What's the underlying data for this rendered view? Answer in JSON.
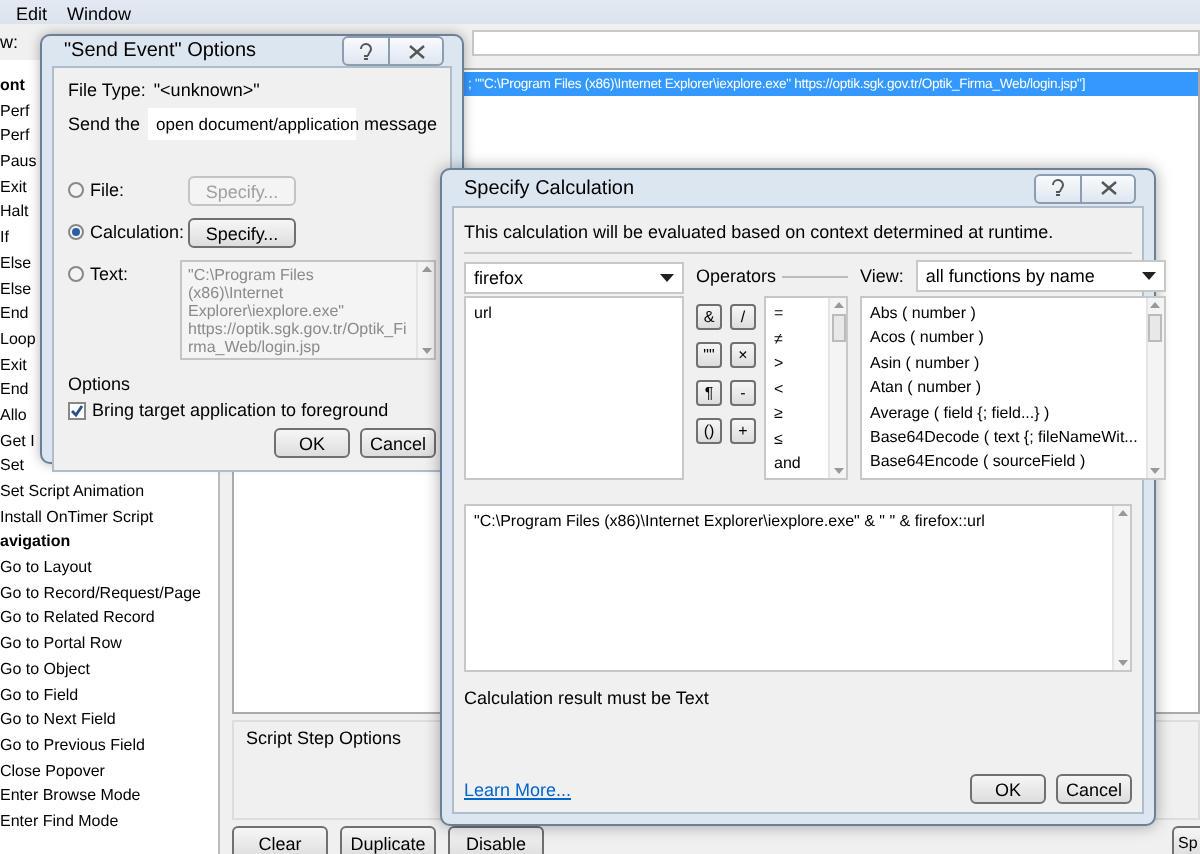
{
  "menu": [
    {
      "label": "Edit"
    },
    {
      "label": "Window"
    }
  ],
  "toolbar": {
    "label": "w:"
  },
  "steps": [
    {
      "label": "ont",
      "kind": "header"
    },
    {
      "label": "Perf",
      "kind": "step"
    },
    {
      "label": "Perf",
      "kind": "step"
    },
    {
      "label": "Paus",
      "kind": "step"
    },
    {
      "label": "Exit",
      "kind": "step"
    },
    {
      "label": "Halt",
      "kind": "step"
    },
    {
      "label": "If",
      "kind": "step"
    },
    {
      "label": "Else",
      "kind": "step"
    },
    {
      "label": "Else",
      "kind": "step"
    },
    {
      "label": "End",
      "kind": "step"
    },
    {
      "label": "Loop",
      "kind": "step"
    },
    {
      "label": "Exit",
      "kind": "step"
    },
    {
      "label": "End",
      "kind": "step"
    },
    {
      "label": "Allo",
      "kind": "step"
    },
    {
      "label": "Get I",
      "kind": "step"
    },
    {
      "label": "Set",
      "kind": "step"
    },
    {
      "label": "Set Script Animation",
      "kind": "step"
    },
    {
      "label": "Install OnTimer Script",
      "kind": "step"
    },
    {
      "label": "avigation",
      "kind": "header"
    },
    {
      "label": "Go to Layout",
      "kind": "step"
    },
    {
      "label": "Go to Record/Request/Page",
      "kind": "step"
    },
    {
      "label": "Go to Related Record",
      "kind": "step"
    },
    {
      "label": "Go to Portal Row",
      "kind": "step"
    },
    {
      "label": "Go to Object",
      "kind": "step"
    },
    {
      "label": "Go to Field",
      "kind": "step"
    },
    {
      "label": "Go to Next Field",
      "kind": "step"
    },
    {
      "label": "Go to Previous Field",
      "kind": "step"
    },
    {
      "label": "Close Popover",
      "kind": "step"
    },
    {
      "label": "Enter Browse Mode",
      "kind": "step"
    },
    {
      "label": "Enter Find Mode",
      "kind": "step"
    }
  ],
  "script_line": {
    "text": "; \"\"C:\\Program Files (x86)\\Internet Explorer\\iexplore.exe\" https://optik.sgk.gov.tr/Optik_Firma_Web/login.jsp\"]",
    "selected": true
  },
  "step_options": {
    "title": "Script Step Options"
  },
  "bottom_buttons": [
    "Clear",
    "Duplicate",
    "Disable",
    "Sp"
  ],
  "send_event": {
    "title": "\"Send Event\" Options",
    "file_type_label": "File Type:",
    "file_type": "\"<unknown>\"",
    "send_label": "Send the",
    "message": "open document/application",
    "message_suffix": "message",
    "sources": [
      {
        "kind": "button",
        "label": "File:",
        "selected": false,
        "button": {
          "label": "Specify...",
          "disabled": true
        }
      },
      {
        "kind": "button",
        "label": "Calculation:",
        "selected": true,
        "button": {
          "label": "Specify...",
          "disabled": false
        }
      },
      {
        "kind": "text",
        "label": "Text:",
        "selected": false,
        "disabled": true,
        "text": "\"C:\\Program Files (x86)\\Internet Explorer\\iexplore.exe\" https://optik.sgk.gov.tr/Optik_Firma_Web/login.jsp"
      }
    ],
    "options_title": "Options",
    "option": {
      "label": "Bring target application to foreground",
      "checked": true
    },
    "buttons": [
      "OK",
      "Cancel"
    ]
  },
  "calc": {
    "title": "Specify Calculation",
    "note": "This calculation will be evaluated based on context determined at runtime.",
    "table": "firefox",
    "fields": [
      "url"
    ],
    "operators_label": "Operators",
    "operator_buttons": [
      "&",
      "/",
      "\"\"",
      "×",
      "¶",
      "-",
      "()",
      "+"
    ],
    "operator_list": [
      "=",
      "≠",
      ">",
      "<",
      "≥",
      "≤",
      "and"
    ],
    "view_label": "View:",
    "view": "all functions by name",
    "functions": [
      "Abs ( number )",
      "Acos ( number )",
      "Asin ( number )",
      "Atan ( number )",
      "Average ( field {; field...} )",
      "Base64Decode ( text {; fileNameWit...",
      "Base64Encode ( sourceField )"
    ],
    "formula": "\"C:\\Program Files (x86)\\Internet Explorer\\iexplore.exe\"  & \" \" & firefox::url",
    "result_note": "Calculation result must be Text",
    "learn_more": "Learn More...",
    "buttons": [
      "OK",
      "Cancel"
    ]
  }
}
